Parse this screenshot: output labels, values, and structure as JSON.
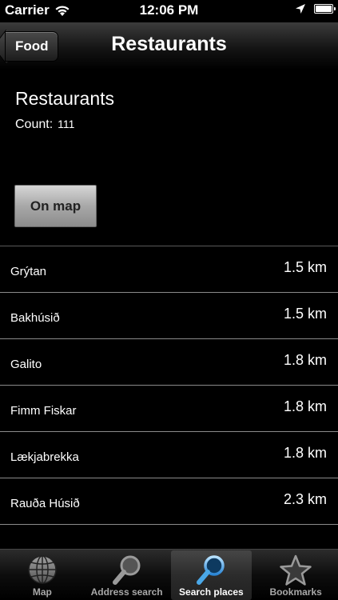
{
  "status_bar": {
    "carrier": "Carrier",
    "time": "12:06 PM"
  },
  "nav": {
    "back_label": "Food",
    "title": "Restaurants"
  },
  "header": {
    "title": "Restaurants",
    "count_label": "Count:",
    "count_value": "111"
  },
  "map_button_label": "On map",
  "places": [
    {
      "name": "Grýtan",
      "distance": "1.5 km"
    },
    {
      "name": "Bakhúsið",
      "distance": "1.5 km"
    },
    {
      "name": "Galito",
      "distance": "1.8 km"
    },
    {
      "name": "Fimm Fiskar",
      "distance": "1.8 km"
    },
    {
      "name": "Lækjabrekka",
      "distance": "1.8 km"
    },
    {
      "name": "Rauða Húsið",
      "distance": "2.3 km"
    }
  ],
  "tabs": [
    {
      "label": "Map",
      "icon": "globe-icon"
    },
    {
      "label": "Address search",
      "icon": "magnifier-icon"
    },
    {
      "label": "Search places",
      "icon": "magnifier-blue-icon",
      "active": true
    },
    {
      "label": "Bookmarks",
      "icon": "star-icon"
    }
  ],
  "colors": {
    "background": "#000000",
    "active_search_icon": "#4aa8e8",
    "divider": "#8a8a8a"
  }
}
